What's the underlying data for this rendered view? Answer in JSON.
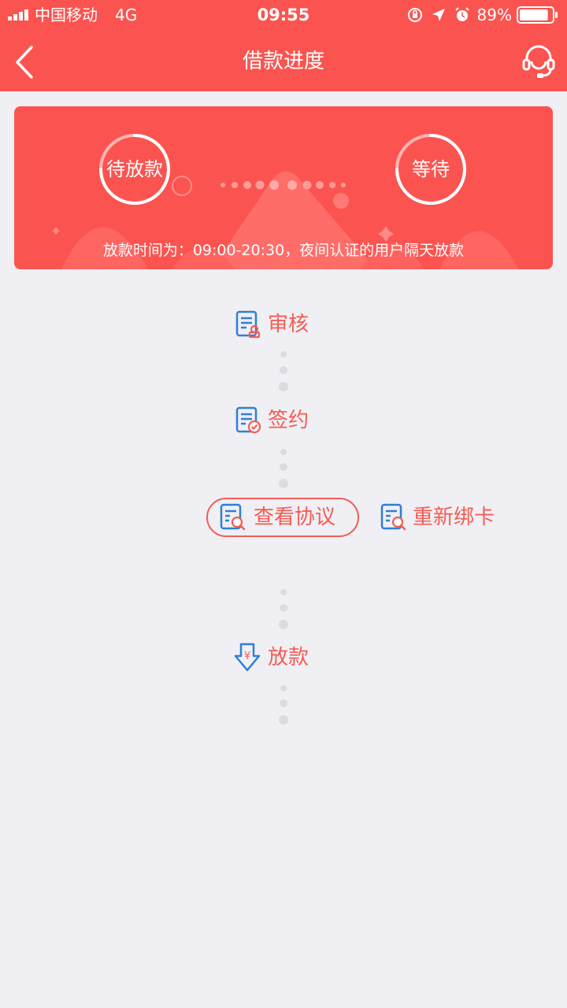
{
  "status_bar": {
    "carrier": "中国移动",
    "network": "4G",
    "time": "09:55",
    "battery": "89%",
    "battery_level": 0.89
  },
  "nav": {
    "title": "借款进度"
  },
  "banner": {
    "current_status": "待放款",
    "next_status": "等待",
    "note": "放款时间为：09:00-20:30，夜间认证的用户隔天放款"
  },
  "steps": {
    "review": "审核",
    "sign": "签约",
    "view_agreement": "查看协议",
    "rebind_card": "重新绑卡",
    "disburse": "放款"
  },
  "colors": {
    "brand_red": "#fb5450",
    "label_red": "#f45c55",
    "icon_blue": "#2f7fd8",
    "background": "#f0eff4"
  }
}
